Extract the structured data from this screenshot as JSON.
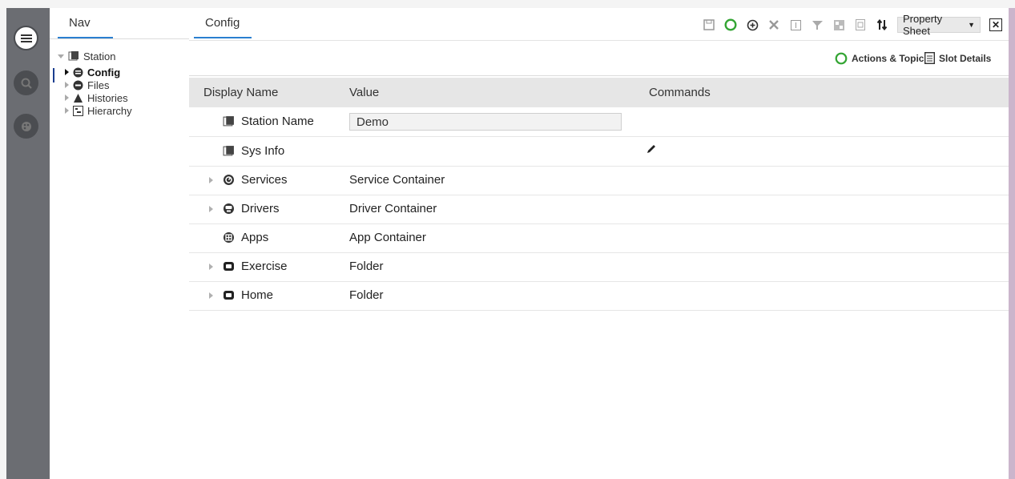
{
  "nav": {
    "tab_label": "Nav",
    "tree": [
      {
        "label": "Station",
        "icon": "station-icon",
        "expanded": true
      },
      {
        "label": "Config",
        "icon": "database-icon",
        "selected": true
      },
      {
        "label": "Files",
        "icon": "files-icon"
      },
      {
        "label": "Histories",
        "icon": "histories-icon"
      },
      {
        "label": "Hierarchy",
        "icon": "hierarchy-icon"
      }
    ]
  },
  "content": {
    "tab_label": "Config",
    "view_select": "Property Sheet",
    "view_select_arrow": "▼",
    "close_glyph": "✕",
    "sub_actions": {
      "actions_topics": "Actions & Topics",
      "slot_details": "Slot Details"
    },
    "table": {
      "headers": [
        "Display Name",
        "Value",
        "Commands"
      ],
      "rows": [
        {
          "name": "Station Name",
          "value": "Demo",
          "editable": true,
          "expandable": false
        },
        {
          "name": "Sys Info",
          "value": "",
          "command_icon": "pencil-icon",
          "expandable": false
        },
        {
          "name": "Services",
          "value": "Service Container",
          "expandable": true
        },
        {
          "name": "Drivers",
          "value": "Driver Container",
          "expandable": true
        },
        {
          "name": "Apps",
          "value": "App Container",
          "expandable": false
        },
        {
          "name": "Exercise",
          "value": "Folder",
          "expandable": true
        },
        {
          "name": "Home",
          "value": "Folder",
          "expandable": true
        }
      ]
    }
  },
  "colors": {
    "accent_tab": "#2a7fd0",
    "status_green": "#34a534",
    "rail": "#6b6d72"
  }
}
